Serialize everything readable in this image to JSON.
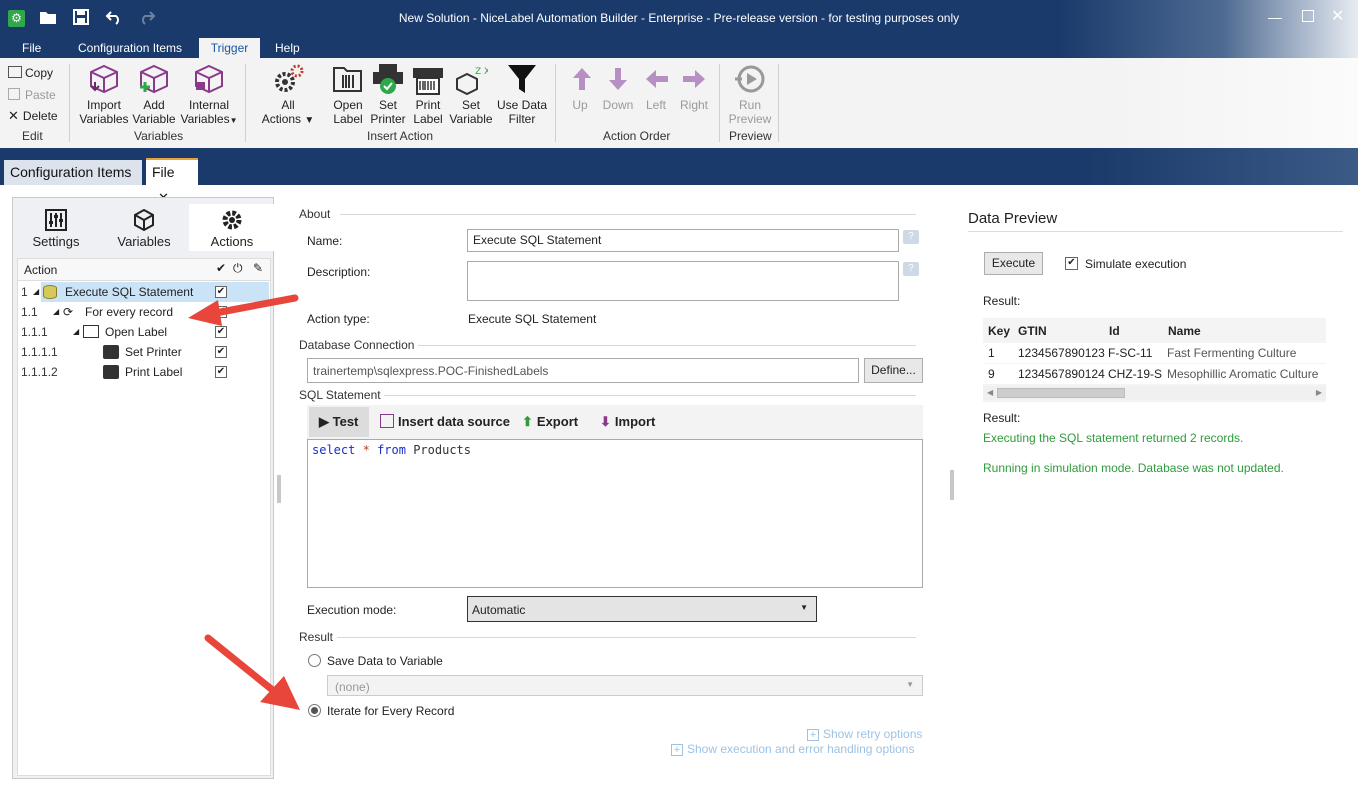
{
  "window": {
    "title": "New Solution - NiceLabel Automation Builder - Enterprise - Pre-release version - for testing purposes only"
  },
  "menu": [
    "File",
    "Configuration Items",
    "Trigger",
    "Help"
  ],
  "ribbon": {
    "edit": {
      "copy": "Copy",
      "paste": "Paste",
      "delete": "Delete",
      "group": "Edit"
    },
    "variables": {
      "import1": "Import",
      "import2": "Variables",
      "add1": "Add",
      "add2": "Variable",
      "internal1": "Internal",
      "internal2": "Variables",
      "group": "Variables"
    },
    "insert_action": {
      "all1": "All",
      "all2": "Actions",
      "open1": "Open",
      "open2": "Label",
      "setp1": "Set",
      "setp2": "Printer",
      "print1": "Print",
      "print2": "Label",
      "setv1": "Set",
      "setv2": "Variable",
      "filter1": "Use Data",
      "filter2": "Filter",
      "group": "Insert Action"
    },
    "action_order": {
      "up": "Up",
      "down": "Down",
      "left": "Left",
      "right": "Right",
      "group": "Action Order"
    },
    "preview": {
      "run1": "Run",
      "run2": "Preview",
      "group": "Preview"
    }
  },
  "doc_tabs": {
    "config": "Configuration Items",
    "file": "File"
  },
  "left": {
    "tabs": {
      "settings": "Settings",
      "variables": "Variables",
      "actions": "Actions"
    },
    "header": "Action",
    "rows": [
      {
        "num": "1",
        "label": "Execute SQL Statement"
      },
      {
        "num": "1.1",
        "label": "For every record"
      },
      {
        "num": "1.1.1",
        "label": "Open Label"
      },
      {
        "num": "1.1.1.1",
        "label": "Set Printer"
      },
      {
        "num": "1.1.1.2",
        "label": "Print Label"
      }
    ]
  },
  "center": {
    "about": "About",
    "name_label": "Name:",
    "name_value": "Execute SQL Statement",
    "desc_label": "Description:",
    "type_label": "Action type:",
    "type_value": "Execute SQL Statement",
    "db_section": "Database Connection",
    "db_value": "trainertemp\\sqlexpress.POC-FinishedLabels",
    "define": "Define...",
    "sql_section": "SQL Statement",
    "toolbar": {
      "test": "Test",
      "insert": "Insert data source",
      "export": "Export",
      "import": "Import"
    },
    "sql": {
      "kw1": "select",
      "star": "*",
      "kw2": "from",
      "table": "Products"
    },
    "exec_label": "Execution mode:",
    "exec_value": "Automatic",
    "result_section": "Result",
    "save_radio": "Save Data to Variable",
    "none_option": "(none)",
    "iterate_radio": "Iterate for Every Record",
    "retry": "Show retry options",
    "error_handling": "Show execution and error handling options"
  },
  "right": {
    "title": "Data Preview",
    "execute": "Execute",
    "simulate": "Simulate execution",
    "result_label": "Result:",
    "columns": [
      "Key",
      "GTIN",
      "Id",
      "Name"
    ],
    "rows": [
      [
        "1",
        "1234567890123",
        "F-SC-11",
        "Fast Fermenting Culture"
      ],
      [
        "9",
        "1234567890124",
        "CHZ-19-S",
        "Mesophillic Aromatic Culture"
      ]
    ],
    "result_label2": "Result:",
    "msg1": "Executing the SQL statement returned 2 records.",
    "msg2": "Running in simulation mode. Database was not updated."
  }
}
